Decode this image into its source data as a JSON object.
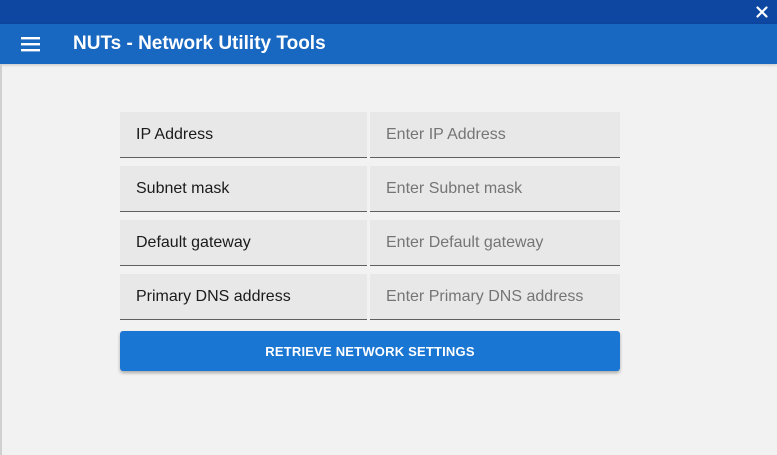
{
  "window": {
    "close_icon": "close-icon"
  },
  "appbar": {
    "menu_icon": "hamburger-menu-icon",
    "title": "NUTs - Network Utility Tools",
    "color": "#1867c0"
  },
  "form": {
    "fields": [
      {
        "label": "IP Address",
        "placeholder": "Enter IP Address",
        "value": ""
      },
      {
        "label": "Subnet mask",
        "placeholder": "Enter Subnet mask",
        "value": ""
      },
      {
        "label": "Default gateway",
        "placeholder": "Enter Default gateway",
        "value": ""
      },
      {
        "label": "Primary DNS address",
        "placeholder": "Enter Primary DNS address",
        "value": ""
      }
    ],
    "button_label": "RETRIEVE NETWORK SETTINGS",
    "button_color": "#1976d2"
  }
}
